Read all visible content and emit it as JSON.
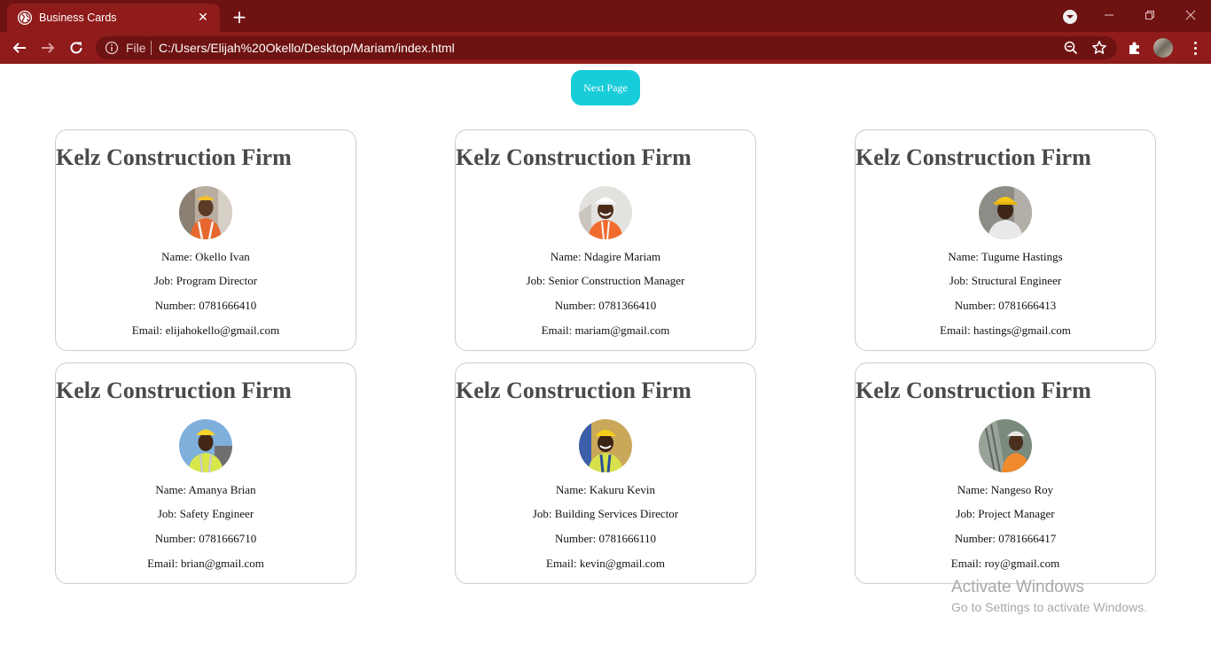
{
  "browser": {
    "tab_title": "Business Cards",
    "tab_close_glyph": "✕",
    "new_tab_glyph": "+",
    "scheme_label": "File",
    "url": "C:/Users/Elijah%20Okello/Desktop/Mariam/index.html",
    "icons": [
      "globe-icon",
      "back-arrow-icon",
      "forward-arrow-icon",
      "reload-icon",
      "info-icon",
      "zoom-icon",
      "star-icon",
      "extensions-icon",
      "profile-avatar",
      "menu-icon"
    ],
    "colors": {
      "tabbar": "#6e1212",
      "toolbar": "#8f1b1b"
    }
  },
  "page": {
    "next_button_label": "Next Page",
    "next_button_color": "#19ccd9"
  },
  "cards": [
    {
      "heading": "Kelz Construction Firm",
      "name": "Name: Okello Ivan",
      "job": "Job: Program Director",
      "number": "Number: 0781666410",
      "email": "Email: elijahokello@gmail.com",
      "photo": "worker-photo-orange-vest"
    },
    {
      "heading": "Kelz Construction Firm",
      "name": "Name: Ndagire Mariam",
      "job": "Job: Senior Construction Manager",
      "number": "Number: 0781366410",
      "email": "Email: mariam@gmail.com",
      "photo": "worker-photo-white-helmet"
    },
    {
      "heading": "Kelz Construction Firm",
      "name": "Name: Tugume Hastings",
      "job": "Job: Structural Engineer",
      "number": "Number: 0781666413",
      "email": "Email: hastings@gmail.com",
      "photo": "worker-photo-yellow-helmet"
    },
    {
      "heading": "Kelz Construction Firm",
      "name": "Name: Amanya Brian",
      "job": "Job: Safety Engineer",
      "number": "Number: 0781666710",
      "email": "Email: brian@gmail.com",
      "photo": "worker-photo-sky-background"
    },
    {
      "heading": "Kelz Construction Firm",
      "name": "Name: Kakuru Kevin",
      "job": "Job: Building Services Director",
      "number": "Number: 0781666110",
      "email": "Email: kevin@gmail.com",
      "photo": "worker-photo-hi-vis"
    },
    {
      "heading": "Kelz Construction Firm",
      "name": "Name: Nangeso Roy",
      "job": "Job: Project Manager",
      "number": "Number: 0781666417",
      "email": "Email: roy@gmail.com",
      "photo": "worker-photo-site"
    }
  ],
  "watermark": {
    "title": "Activate Windows",
    "subtitle": "Go to Settings to activate Windows."
  }
}
